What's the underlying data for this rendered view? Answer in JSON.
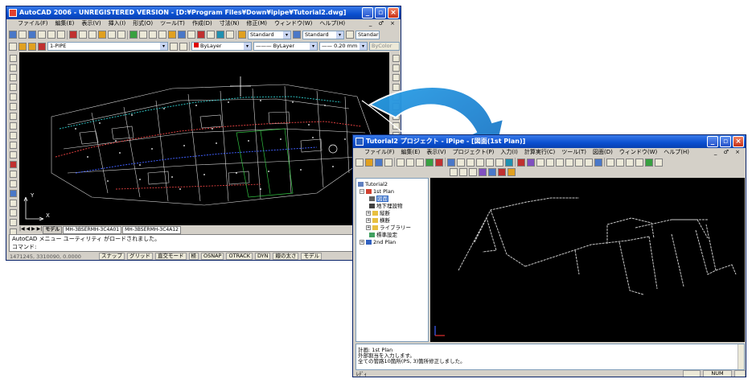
{
  "autocad": {
    "title": "AutoCAD 2006 - UNREGISTERED VERSION - [D:¥Program Files¥Down¥ipipe¥Tutorial2.dwg]",
    "menu": [
      "ファイル(F)",
      "編集(E)",
      "表示(V)",
      "挿入(I)",
      "形式(O)",
      "ツール(T)",
      "作成(D)",
      "寸法(N)",
      "修正(M)",
      "ウィンドウ(W)",
      "ヘルプ(H)"
    ],
    "mdi_controls": "_ ♂ ×",
    "styles": {
      "text_style": "Standard",
      "dim_style": "Standard",
      "table_style": "Standard"
    },
    "layer_combo": "1-PIPE",
    "color_combo": "ByLayer",
    "linetype_combo": "ByLayer",
    "lineweight_combo": "0.20 mm",
    "plotstyle_combo": "ByColor",
    "ucs_x": "X",
    "ucs_y": "Y",
    "tabs": [
      "モデル",
      "MH-3BSERMH-3C4A01",
      "MH-3BSERMH-3C4A12"
    ],
    "command_lines": [
      "AutoCAD メニュー ユーティリティ がロードされました。",
      "コマンド:"
    ],
    "coords": "1471245, 3310090, 0.0000",
    "status_toggles": [
      "スナップ",
      "グリッド",
      "直交モード",
      "極",
      "OSNAP",
      "OTRACK",
      "DYN",
      "線の太さ",
      "モデル"
    ]
  },
  "ipipe": {
    "title": "Tutorial2 プロジェクト - iPipe - [図面(1st Plan)]",
    "menu": [
      "ファイル(F)",
      "編集(E)",
      "表示(V)",
      "プロジェクト(P)",
      "入力(I)",
      "計算実行(C)",
      "ツール(T)",
      "図面(D)",
      "ウィンドウ(W)",
      "ヘルプ(H)"
    ],
    "mdi_controls": "_ ♂ ×",
    "tree": {
      "root": "Tutorial2",
      "plan1": "1st Plan",
      "drawing": "図面",
      "underground": "地下埋設物",
      "section": "縦断",
      "cross": "横断",
      "library": "ライブラリー",
      "standard": "標準設定",
      "plan2": "2nd Plan"
    },
    "output_lines": [
      "計画: 1st Plan",
      "外部割当を入力します。",
      "全ての管路10箇所(PS, 3)箇所修正しました。"
    ],
    "status_left": "ﾚﾃﾞｨ",
    "status_right": "NUM"
  },
  "colors": {
    "titlebar": "#0a4fd0",
    "canvas": "#000000",
    "arrow": "#2aa0e8",
    "pipe_red": "#e04040",
    "pipe_cyan": "#30d0d0",
    "pipe_green": "#30c040",
    "pipe_blue": "#4060ff",
    "ipipe_lines": "#c8c8c8"
  }
}
